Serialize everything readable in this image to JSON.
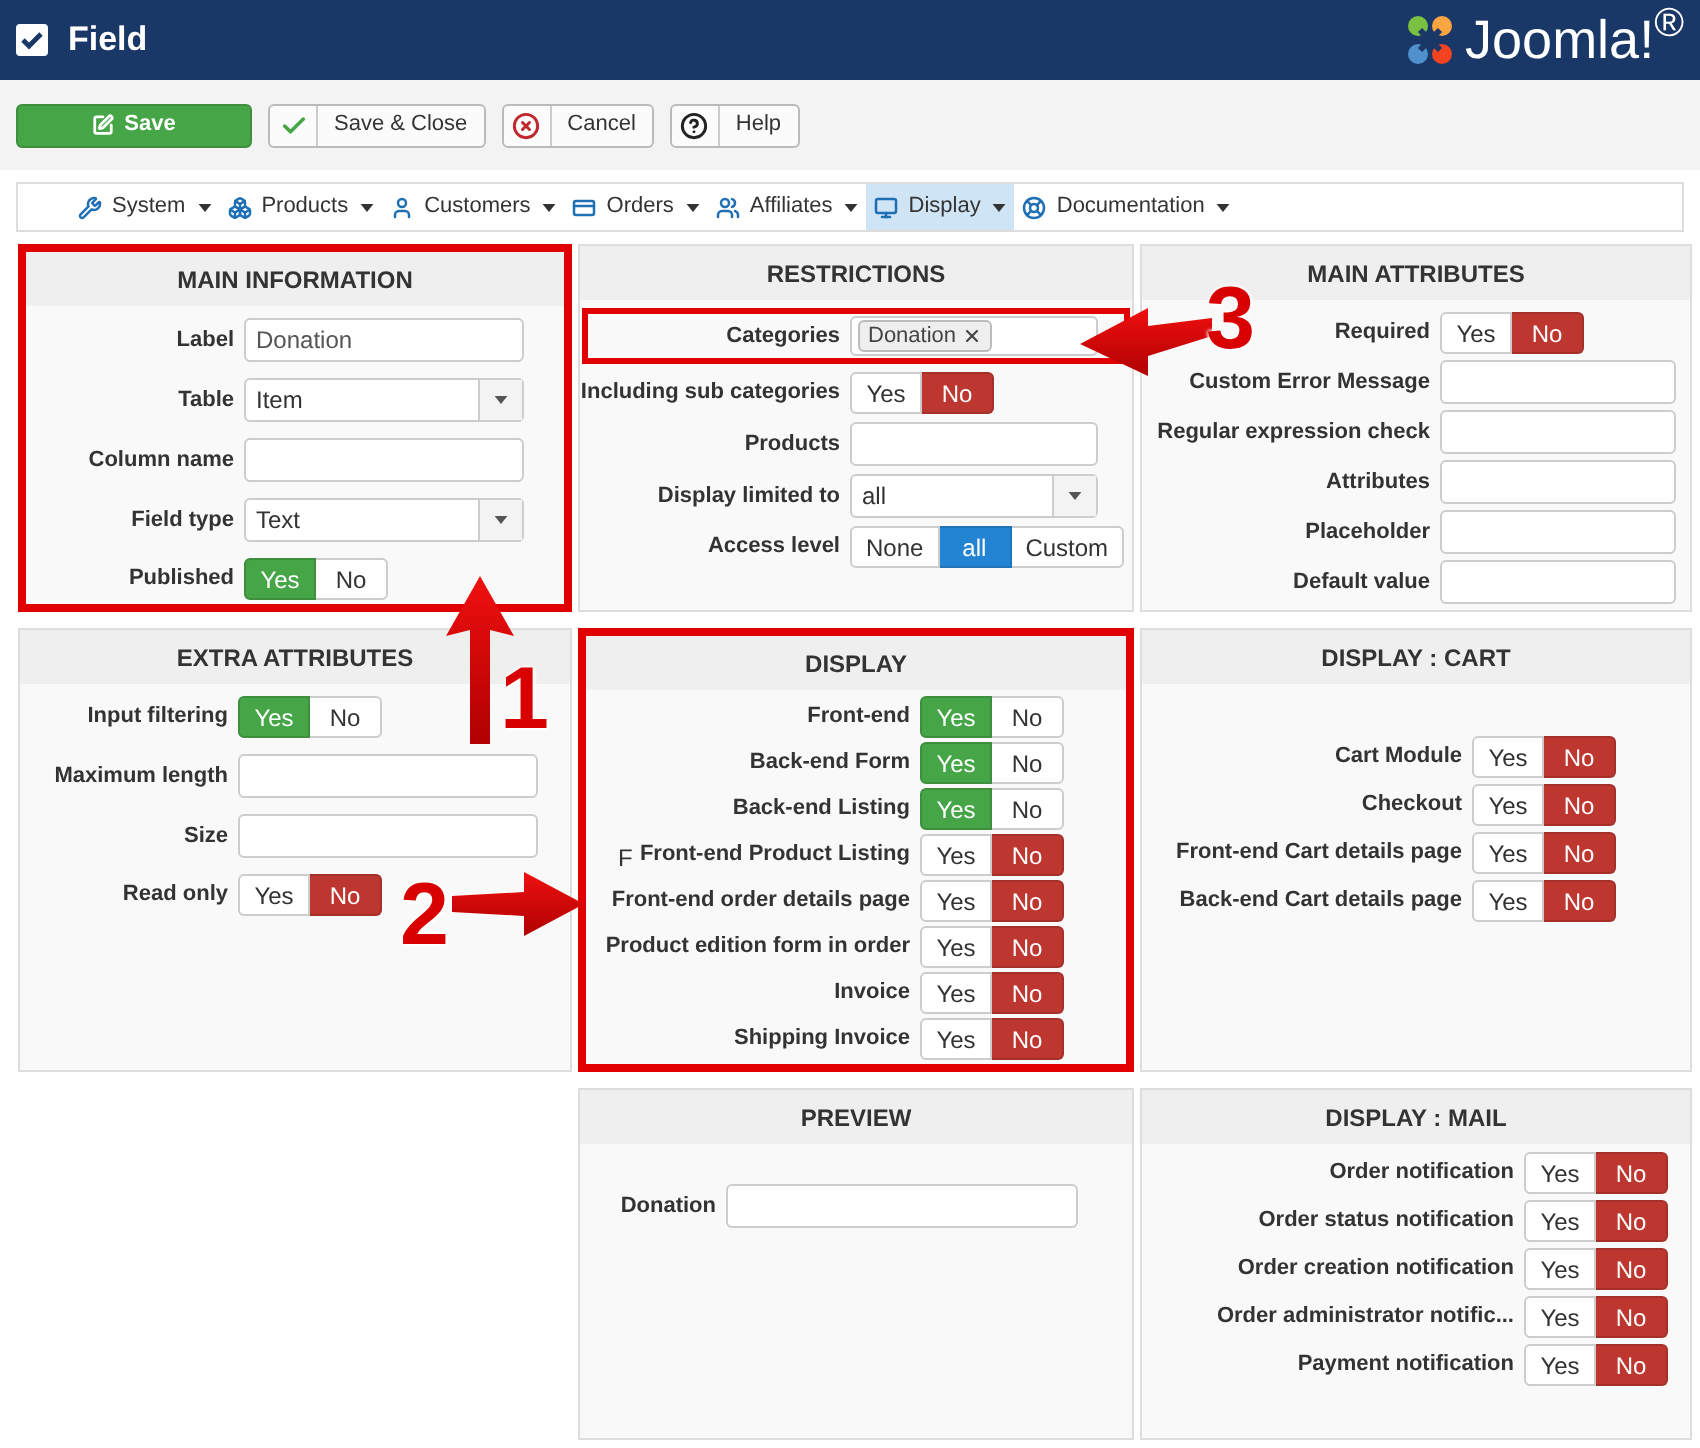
{
  "window": {
    "title": "Field",
    "brand": "Joomla!$^{®}$"
  },
  "toolbar": [
    {
      "label": "Save",
      "kind": "primary"
    },
    {
      "label": "Save & Close",
      "kind": "check"
    },
    {
      "label": "Cancel",
      "kind": "cancel"
    },
    {
      "label": "Help",
      "kind": "help"
    }
  ],
  "menu": [
    {
      "label": "System",
      "kind": "wrench",
      "selected": false
    },
    {
      "label": "Products",
      "kind": "boxes",
      "selected": false
    },
    {
      "label": "Customers",
      "kind": "user",
      "selected": false
    },
    {
      "label": "Orders",
      "kind": "card",
      "selected": false
    },
    {
      "label": "Affiliates",
      "kind": "users",
      "selected": false
    },
    {
      "label": "Display",
      "kind": "monitor",
      "selected": true
    },
    {
      "label": "Documentation",
      "kind": "lifebuoy",
      "selected": false
    }
  ],
  "panels": [
    {
      "title": "MAIN INFORMATION",
      "highlighted": true,
      "fields": [
        {
          "kind": "text",
          "label": "Label",
          "value": "Donation"
        },
        {
          "kind": "select",
          "label": "Table",
          "value": "Item"
        },
        {
          "kind": "text",
          "label": "Column name"
        },
        {
          "kind": "select",
          "label": "Field type",
          "value": "Text"
        },
        {
          "kind": "toggle",
          "label": "Published",
          "options": [
            {
              "label": "Yes",
              "selected": true
            },
            {
              "label": "No",
              "selected": false
            }
          ]
        }
      ]
    },
    {
      "title": "RESTRICTIONS",
      "highlighted": false,
      "fields": [
        {
          "kind": "tags",
          "label": "Categories",
          "highlighted": true,
          "tags": [
            "Donation"
          ]
        },
        {
          "kind": "toggle",
          "label": "Including sub categories",
          "options": [
            {
              "label": "Yes",
              "selected": false
            },
            {
              "label": "No",
              "selected": true
            }
          ]
        },
        {
          "kind": "text",
          "label": "Products"
        },
        {
          "kind": "select",
          "label": "Display limited to",
          "value": "all"
        },
        {
          "kind": "toggle",
          "label": "Access level",
          "options": [
            {
              "label": "None",
              "selected": false
            },
            {
              "label": "all",
              "selected": true
            },
            {
              "label": "Custom",
              "selected": false
            }
          ]
        }
      ]
    },
    {
      "title": "MAIN ATTRIBUTES",
      "highlighted": false,
      "fields": [
        {
          "kind": "toggle",
          "label": "Required",
          "options": [
            {
              "label": "Yes",
              "selected": false
            },
            {
              "label": "No",
              "selected": true
            }
          ]
        },
        {
          "kind": "text",
          "label": "Custom Error Message"
        },
        {
          "kind": "text",
          "label": "Regular expression check"
        },
        {
          "kind": "text",
          "label": "Attributes"
        },
        {
          "kind": "text",
          "label": "Placeholder"
        },
        {
          "kind": "text",
          "label": "Default value"
        }
      ]
    },
    {
      "title": "EXTRA ATTRIBUTES",
      "highlighted": false,
      "fields": [
        {
          "kind": "toggle",
          "label": "Input filtering",
          "options": [
            {
              "label": "Yes",
              "selected": true
            },
            {
              "label": "No",
              "selected": false
            }
          ]
        },
        {
          "kind": "text",
          "label": "Maximum length"
        },
        {
          "kind": "text",
          "label": "Size"
        },
        {
          "kind": "toggle",
          "label": "Read only",
          "options": [
            {
              "label": "Yes",
              "selected": false
            },
            {
              "label": "No",
              "selected": true
            }
          ]
        }
      ]
    },
    {
      "title": "DISPLAY",
      "highlighted": true,
      "fields": [
        {
          "kind": "toggle",
          "label": "Front-end",
          "options": [
            {
              "label": "Yes",
              "selected": true
            },
            {
              "label": "No",
              "selected": false
            }
          ]
        },
        {
          "kind": "toggle",
          "label": "Back-end Form",
          "options": [
            {
              "label": "Yes",
              "selected": true
            },
            {
              "label": "No",
              "selected": false
            }
          ]
        },
        {
          "kind": "toggle",
          "label": "Back-end Listing",
          "options": [
            {
              "label": "Yes",
              "selected": true
            },
            {
              "label": "No",
              "selected": false
            }
          ]
        },
        {
          "kind": "toggle",
          "label": "Front-end Product Listing",
          "prefix": "F",
          "options": [
            {
              "label": "Yes",
              "selected": false
            },
            {
              "label": "No",
              "selected": true
            }
          ]
        },
        {
          "kind": "toggle",
          "label": "Front-end order details page",
          "options": [
            {
              "label": "Yes",
              "selected": false
            },
            {
              "label": "No",
              "selected": true
            }
          ]
        },
        {
          "kind": "toggle",
          "label": "Product edition form in order",
          "options": [
            {
              "label": "Yes",
              "selected": false
            },
            {
              "label": "No",
              "selected": true
            }
          ]
        },
        {
          "kind": "toggle",
          "label": "Invoice",
          "options": [
            {
              "label": "Yes",
              "selected": false
            },
            {
              "label": "No",
              "selected": true
            }
          ]
        },
        {
          "kind": "toggle",
          "label": "Shipping Invoice",
          "options": [
            {
              "label": "Yes",
              "selected": false
            },
            {
              "label": "No",
              "selected": true
            }
          ]
        }
      ]
    },
    {
      "title": "DISPLAY : CART",
      "highlighted": false,
      "fields": [
        {
          "kind": "toggle",
          "label": "Cart Module",
          "options": [
            {
              "label": "Yes",
              "selected": false
            },
            {
              "label": "No",
              "selected": true
            }
          ]
        },
        {
          "kind": "toggle",
          "label": "Checkout",
          "options": [
            {
              "label": "Yes",
              "selected": false
            },
            {
              "label": "No",
              "selected": true
            }
          ]
        },
        {
          "kind": "toggle",
          "label": "Front-end Cart details page",
          "options": [
            {
              "label": "Yes",
              "selected": false
            },
            {
              "label": "No",
              "selected": true
            }
          ]
        },
        {
          "kind": "toggle",
          "label": "Back-end Cart details page",
          "options": [
            {
              "label": "Yes",
              "selected": false
            },
            {
              "label": "No",
              "selected": true
            }
          ]
        }
      ]
    },
    {
      "title": "PREVIEW",
      "highlighted": false,
      "fields": [
        {
          "kind": "text",
          "label": "Donation"
        }
      ]
    },
    {
      "title": "DISPLAY : MAIL",
      "highlighted": false,
      "fields": [
        {
          "kind": "toggle",
          "label": "Order notification",
          "options": [
            {
              "label": "Yes",
              "selected": false
            },
            {
              "label": "No",
              "selected": true
            }
          ]
        },
        {
          "kind": "toggle",
          "label": "Order status notification",
          "options": [
            {
              "label": "Yes",
              "selected": false
            },
            {
              "label": "No",
              "selected": true
            }
          ]
        },
        {
          "kind": "toggle",
          "label": "Order creation notification",
          "options": [
            {
              "label": "Yes",
              "selected": false
            },
            {
              "label": "No",
              "selected": true
            }
          ]
        },
        {
          "kind": "toggle",
          "label": "Order administrator notific...",
          "options": [
            {
              "label": "Yes",
              "selected": false
            },
            {
              "label": "No",
              "selected": true
            }
          ]
        },
        {
          "kind": "toggle",
          "label": "Payment notification",
          "options": [
            {
              "label": "Yes",
              "selected": false
            },
            {
              "label": "No",
              "selected": true
            }
          ]
        }
      ]
    }
  ],
  "annotations": [
    {
      "number": "1"
    },
    {
      "number": "2"
    },
    {
      "number": "3"
    }
  ]
}
